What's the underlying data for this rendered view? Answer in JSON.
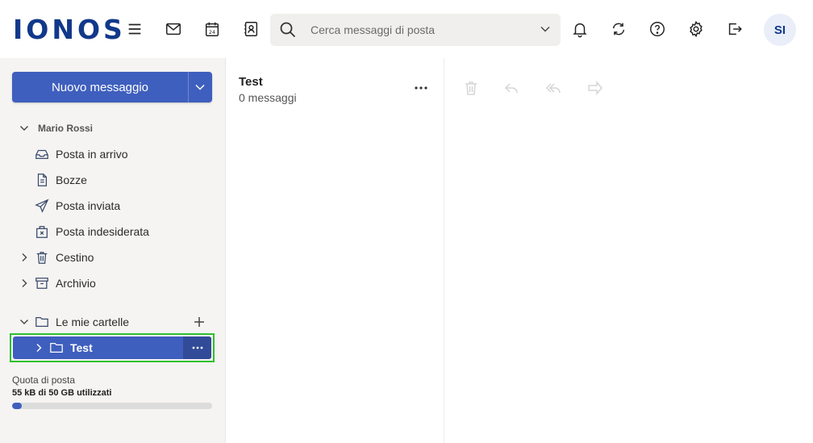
{
  "header": {
    "logo_text": "IONOS",
    "search": {
      "placeholder": "Cerca messaggi di posta"
    },
    "avatar_initials": "SI",
    "icons": [
      "menu-icon",
      "mail-icon",
      "calendar-icon",
      "contacts-icon",
      "bell-icon",
      "sync-icon",
      "help-icon",
      "gear-icon",
      "logout-icon"
    ],
    "calendar_day": "24"
  },
  "sidebar": {
    "new_message_label": "Nuovo messaggio",
    "account_name": "Mario Rossi",
    "folders": [
      {
        "label": "Posta in arrivo",
        "icon": "inbox-icon"
      },
      {
        "label": "Bozze",
        "icon": "drafts-icon"
      },
      {
        "label": "Posta inviata",
        "icon": "sent-icon"
      },
      {
        "label": "Posta indesiderata",
        "icon": "spam-icon"
      },
      {
        "label": "Cestino",
        "icon": "trash-icon"
      },
      {
        "label": "Archivio",
        "icon": "archive-icon"
      }
    ],
    "my_folders_label": "Le mie cartelle",
    "selected_folder": "Test",
    "quota": {
      "label": "Quota di posta",
      "value": "55 kB di 50 GB utilizzati",
      "used_fraction": 0.05
    }
  },
  "message_list": {
    "folder_title": "Test",
    "count_text": "0 messaggi"
  },
  "reader_toolbar": {
    "icons": [
      "delete-icon",
      "reply-icon",
      "reply-all-icon",
      "forward-icon"
    ]
  },
  "colors": {
    "brand": "#11388a",
    "accent": "#3f5fbe",
    "sidebar_bg": "#f5f4f2",
    "highlight": "#2fc02f"
  }
}
